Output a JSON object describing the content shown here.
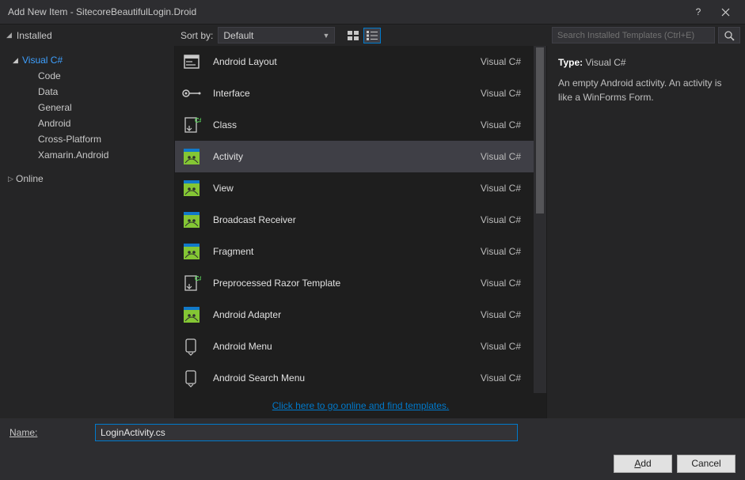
{
  "window": {
    "title": "Add New Item - SitecoreBeautifulLogin.Droid"
  },
  "toolbar": {
    "installed_tab": "Installed",
    "sort_label": "Sort by:",
    "sort_value": "Default",
    "search_placeholder": "Search Installed Templates (Ctrl+E)"
  },
  "tree": {
    "root": {
      "label": "Visual C#",
      "children": [
        "Code",
        "Data",
        "General",
        "Android",
        "Cross-Platform",
        "Xamarin.Android"
      ]
    },
    "online": "Online"
  },
  "templates": [
    {
      "name": "Android Layout",
      "lang": "Visual C#",
      "icon": "layout"
    },
    {
      "name": "Interface",
      "lang": "Visual C#",
      "icon": "interface"
    },
    {
      "name": "Class",
      "lang": "Visual C#",
      "icon": "class"
    },
    {
      "name": "Activity",
      "lang": "Visual C#",
      "icon": "android",
      "selected": true
    },
    {
      "name": "View",
      "lang": "Visual C#",
      "icon": "android"
    },
    {
      "name": "Broadcast Receiver",
      "lang": "Visual C#",
      "icon": "android"
    },
    {
      "name": "Fragment",
      "lang": "Visual C#",
      "icon": "android"
    },
    {
      "name": "Preprocessed Razor Template",
      "lang": "Visual C#",
      "icon": "class"
    },
    {
      "name": "Android Adapter",
      "lang": "Visual C#",
      "icon": "android"
    },
    {
      "name": "Android Menu",
      "lang": "Visual C#",
      "icon": "menu"
    },
    {
      "name": "Android Search Menu",
      "lang": "Visual C#",
      "icon": "menu"
    }
  ],
  "online_link": "Click here to go online and find templates.",
  "details": {
    "type_label": "Type:",
    "type_value": "Visual C#",
    "description": "An empty Android activity.  An activity is like a WinForms Form."
  },
  "name_field": {
    "label": "Name:",
    "value": "LoginActivity.cs"
  },
  "buttons": {
    "add": "Add",
    "cancel": "Cancel"
  }
}
